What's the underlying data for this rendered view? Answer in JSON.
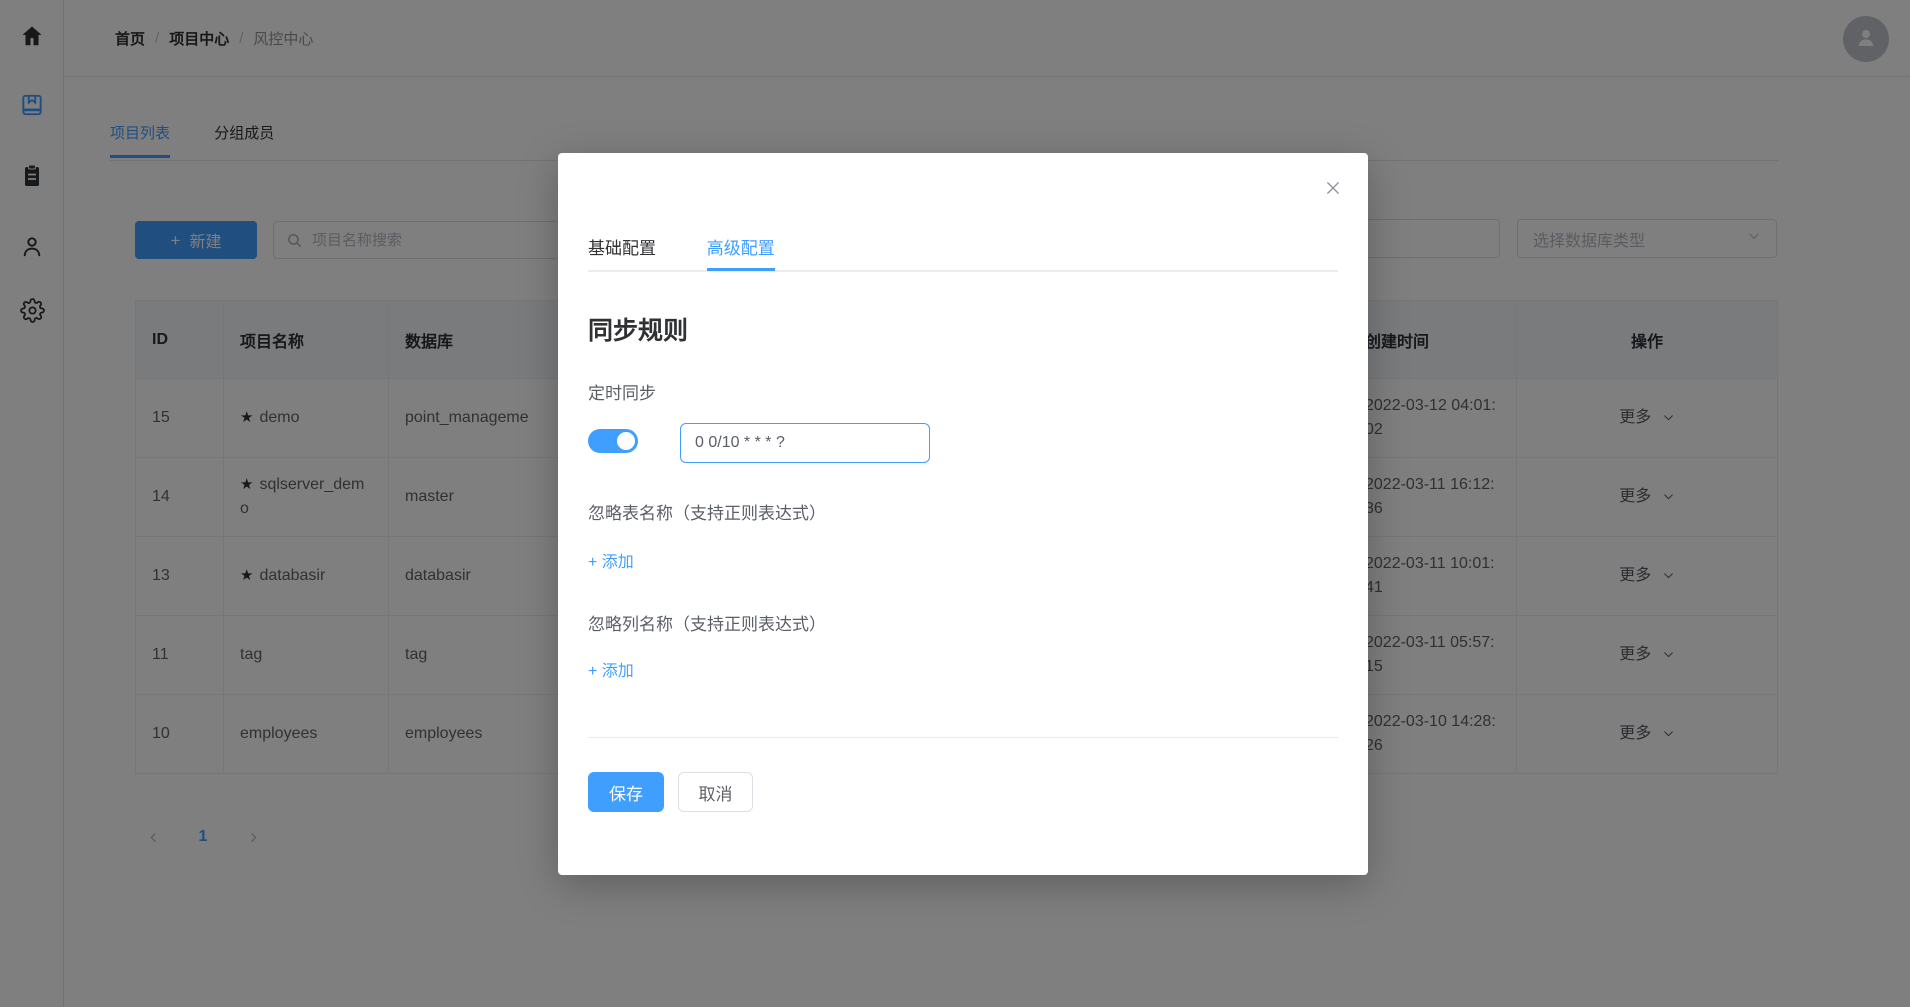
{
  "colors": {
    "accent": "#409eff",
    "text_primary": "#303133",
    "text_regular": "#606266",
    "border": "#dcdfe6",
    "table_border": "#ebeef5",
    "table_header_bg": "#f5f7fa",
    "overlay": "rgba(0,0,0,0.5)"
  },
  "sidebar": {
    "items": [
      {
        "icon": "home-icon",
        "active": false
      },
      {
        "icon": "book-icon",
        "active": true
      },
      {
        "icon": "clipboard-icon",
        "active": false
      },
      {
        "icon": "user-icon",
        "active": false
      },
      {
        "icon": "gear-icon",
        "active": false
      }
    ]
  },
  "topbar": {
    "breadcrumb": {
      "items": [
        "首页",
        "项目中心",
        "风控中心"
      ],
      "separator": "/"
    }
  },
  "tabs": {
    "items": [
      {
        "label": "项目列表",
        "active": true
      },
      {
        "label": "分组成员",
        "active": false
      }
    ]
  },
  "toolbar": {
    "new_button_plus": "+",
    "new_button_label": "新建",
    "search_placeholder": "项目名称搜索",
    "db_filter_value": "",
    "db_type_placeholder": "选择数据库类型"
  },
  "table": {
    "columns": [
      "ID",
      "项目名称",
      "数据库",
      "创建时间",
      "操作"
    ],
    "more_label": "更多",
    "rows": [
      {
        "id": "15",
        "star": "★",
        "name": "demo",
        "database": "point_manageme",
        "created": "2022-03-12 04:01:02"
      },
      {
        "id": "14",
        "star": "★",
        "name": "sqlserver_demo",
        "database": "master",
        "created": "2022-03-11 16:12:36"
      },
      {
        "id": "13",
        "star": "★",
        "name": "databasir",
        "database": "databasir",
        "created": "2022-03-11 10:01:41"
      },
      {
        "id": "11",
        "star": "",
        "name": "tag",
        "database": "tag",
        "created": "2022-03-11 05:57:15"
      },
      {
        "id": "10",
        "star": "",
        "name": "employees",
        "database": "employees",
        "created": "2022-03-10 14:28:26"
      }
    ]
  },
  "pagination": {
    "current_page": "1"
  },
  "modal": {
    "tabs": [
      {
        "label": "基础配置",
        "active": false
      },
      {
        "label": "高级配置",
        "active": true
      }
    ],
    "title": "同步规则",
    "cron_label": "定时同步",
    "cron_toggle_on": true,
    "cron_value": "0 0/10 * * * ?",
    "ignore_tables_label": "忽略表名称（支持正则表达式）",
    "ignore_tables_add_link": "+ 添加",
    "ignore_columns_label": "忽略列名称（支持正则表达式）",
    "ignore_columns_add_link": "+ 添加",
    "save_label": "保存",
    "cancel_label": "取消"
  }
}
